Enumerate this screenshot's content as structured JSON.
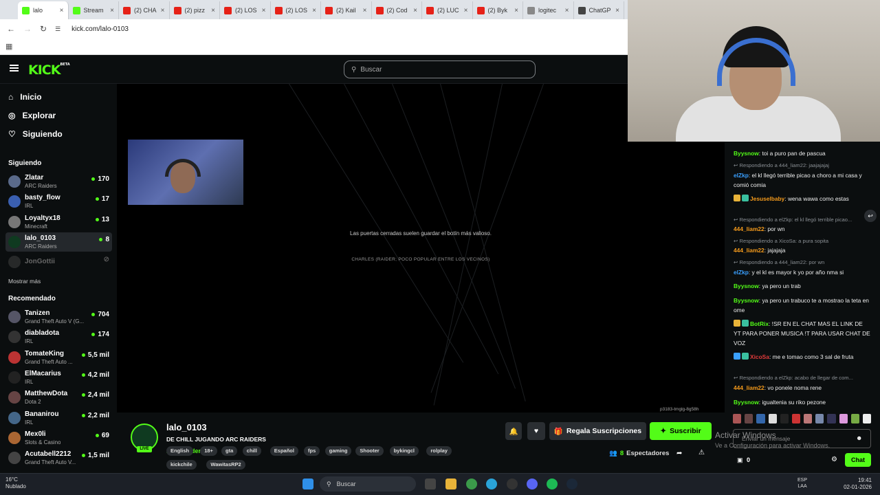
{
  "browser": {
    "tabs": [
      {
        "label": "lalo",
        "fav": "#53fc18",
        "active": true
      },
      {
        "label": "Stream",
        "fav": "#53fc18"
      },
      {
        "label": "(2) CHA",
        "fav": "#e62117"
      },
      {
        "label": "(2) pizz",
        "fav": "#e62117"
      },
      {
        "label": "(2) LOS",
        "fav": "#e62117"
      },
      {
        "label": "(2) LOS",
        "fav": "#e62117"
      },
      {
        "label": "(2) Kail",
        "fav": "#e62117"
      },
      {
        "label": "(2) Cod",
        "fav": "#e62117"
      },
      {
        "label": "(2) LUC",
        "fav": "#e62117"
      },
      {
        "label": "(2) Byk",
        "fav": "#e62117"
      },
      {
        "label": "logitec",
        "fav": "#888"
      },
      {
        "label": "ChatGP",
        "fav": "#444"
      }
    ],
    "url": "kick.com/lalo-0103"
  },
  "header": {
    "logo": "KICK",
    "logo_sup": "BETA",
    "search_placeholder": "Buscar"
  },
  "sidebar": {
    "nav": [
      {
        "label": "Inicio",
        "icon": "home-icon"
      },
      {
        "label": "Explorar",
        "icon": "compass-icon"
      },
      {
        "label": "Siguiendo",
        "icon": "heart-icon"
      }
    ],
    "following_title": "Siguiendo",
    "following": [
      {
        "name": "Zlatar",
        "game": "ARC Raiders",
        "viewers": "170",
        "color": "#5a6a8a"
      },
      {
        "name": "basty_flow",
        "game": "IRL",
        "viewers": "17",
        "color": "#3a5fb0"
      },
      {
        "name": "Loyaltyx18",
        "game": "Minecraft",
        "viewers": "13",
        "color": "#777"
      },
      {
        "name": "lalo_0103",
        "game": "ARC Raiders",
        "viewers": "8",
        "color": "#0f3a20"
      }
    ],
    "offline": {
      "name": "JonGottii"
    },
    "show_more": "Mostrar más",
    "recommended_title": "Recomendado",
    "recommended": [
      {
        "name": "Tanizen",
        "game": "Grand Theft Auto V (G...",
        "viewers": "704",
        "color": "#556"
      },
      {
        "name": "diabladota",
        "game": "IRL",
        "viewers": "174",
        "color": "#333"
      },
      {
        "name": "TomateKing",
        "game": "Grand Theft Auto ...",
        "viewers": "5,5 mil",
        "color": "#b33"
      },
      {
        "name": "ElMacarius",
        "game": "IRL",
        "viewers": "4,2 mil",
        "color": "#222"
      },
      {
        "name": "MatthewDota",
        "game": "Dota 2",
        "viewers": "2,4 mil",
        "color": "#644"
      },
      {
        "name": "Bananirou",
        "game": "IRL",
        "viewers": "2,2 mil",
        "color": "#468"
      },
      {
        "name": "Mex0li",
        "game": "Slots & Casino",
        "viewers": "69",
        "color": "#a63"
      },
      {
        "name": "Acutabell2212",
        "game": "Grand Theft Auto V...",
        "viewers": "1,5 mil",
        "color": "#444"
      }
    ]
  },
  "player": {
    "loading_tip": "Las puertas cerradas suelen guardar el botín más valioso.",
    "loading_sub": "CHARLES (RAIDER; POCO POPULAR ENTRE LOS VECINOS)",
    "build_id": "p3183-tmglg-8g58h"
  },
  "stream": {
    "live": "LIVE",
    "name": "lalo_0103",
    "title": "DE CHILL JUGANDO ARC RAIDERS",
    "game": "ARC Raiders",
    "tags_row1": [
      "English",
      "18+",
      "gta",
      "chill",
      "Español",
      "fps",
      "gaming",
      "Shooter",
      "bykingcl",
      "rolplay"
    ],
    "tags_row2": [
      "kickchile",
      "WawitasRP2"
    ],
    "gift_label": "Regala Suscripciones",
    "subscribe_label": "Suscribir",
    "viewers_count": "8",
    "viewers_label": "Espectadores"
  },
  "chat": {
    "messages": [
      {
        "type": "msg",
        "user": "Byysnow",
        "color": "#53fc18",
        "text": "toi a puro pan de pascua"
      },
      {
        "type": "reply",
        "text": "Respondiendo a 444_liam22: jaajajajaj"
      },
      {
        "type": "msg",
        "user": "elZkp",
        "color": "#3aa0ff",
        "text": "el kl llegó terrible picao a choro a mi casa y comió comia"
      },
      {
        "type": "msg",
        "user": "Jesuselbaby",
        "color": "#f59b1c",
        "text": "wena wawa como estas"
      },
      {
        "type": "reply",
        "text": "Respondiendo a elZkp: el kl llegó terrible picao..."
      },
      {
        "type": "msg",
        "user": "444_liam22",
        "color": "#f59b1c",
        "text": "por wn"
      },
      {
        "type": "reply",
        "text": "Respondiendo a XicoSa: a pura sopita"
      },
      {
        "type": "msg",
        "user": "444_liam22",
        "color": "#f59b1c",
        "text": "jajajaja"
      },
      {
        "type": "reply",
        "text": "Respondiendo a 444_liam22: por wn"
      },
      {
        "type": "msg",
        "user": "elZkp",
        "color": "#3aa0ff",
        "text": "y el kl es mayor k yo por año nma si"
      },
      {
        "type": "msg",
        "user": "Byysnow",
        "color": "#53fc18",
        "text": "ya pero un trab"
      },
      {
        "type": "msg",
        "user": "Byysnow",
        "color": "#53fc18",
        "text": "ya pero un trabuco te a mostrao la teta en ome"
      },
      {
        "type": "msg",
        "user": "BotRix",
        "color": "#53fc18",
        "text": "!SR EN EL CHAT MAS EL LINK DE YT PARA PONER MUSICA !T PARA USAR CHAT DE VOZ"
      },
      {
        "type": "msg",
        "user": "XicoSa",
        "color": "#e23b3b",
        "text": "me e tomao como 3 sal de fruta"
      },
      {
        "type": "reply",
        "text": "Respondiendo a elZkp: acabo de llegar de com..."
      },
      {
        "type": "msg",
        "user": "444_liam22",
        "color": "#f59b1c",
        "text": "vo ponele noma rene"
      },
      {
        "type": "msg",
        "user": "Byysnow",
        "color": "#53fc18",
        "text": "igualtenia su riko pezone"
      }
    ],
    "input_placeholder": "Enviar un mensaje",
    "points": "0",
    "chat_button": "Chat"
  },
  "windows": {
    "activate_title": "Activar Windows",
    "activate_sub": "Ve a Configuración para activar Windows.",
    "weather_temp": "16°C",
    "weather_desc": "Nublado",
    "search": "Buscar",
    "lang1": "ESP",
    "lang2": "LAA",
    "time": "19:41",
    "date": "02-01-2026"
  }
}
